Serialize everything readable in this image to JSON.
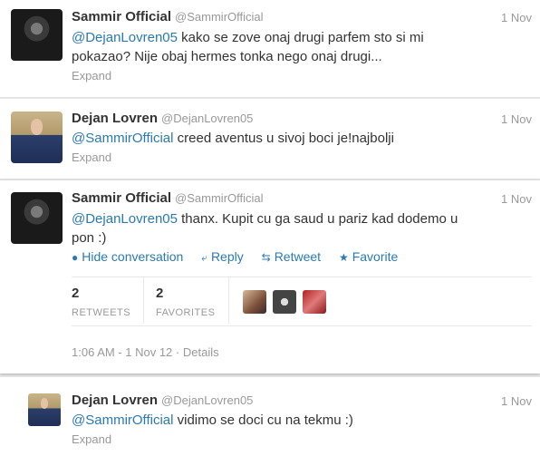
{
  "tweets": [
    {
      "name": "Sammir Official",
      "handle": "@SammirOfficial",
      "date": "1 Nov",
      "mention": "@DejanLovren05",
      "body_line1": " kako se zove onaj drugi parfem sto si mi",
      "body_line2": "pokazao? Nije obaj hermes tonka nego onaj drugi...",
      "expand": "Expand",
      "avatar_icon": "player-avatar-dark"
    },
    {
      "name": "Dejan Lovren",
      "handle": "@DejanLovren05",
      "date": "1 Nov",
      "mention": "@SammirOfficial",
      "body_line1": " creed aventus u sivoj boci je!najbolji",
      "expand": "Expand",
      "avatar_icon": "player-avatar-suit"
    },
    {
      "name": "Sammir Official",
      "handle": "@SammirOfficial",
      "date": "1 Nov",
      "mention": "@DejanLovren05",
      "body_line1": " thanx. Kupit cu ga saud u pariz kad dodemo u",
      "body_line2": "pon :)",
      "actions": {
        "hide": "Hide conversation",
        "reply": "Reply",
        "retweet": "Retweet",
        "favorite": "Favorite"
      },
      "stats": {
        "retweets_count": "2",
        "retweets_label": "RETWEETS",
        "favorites_count": "2",
        "favorites_label": "FAVORITES"
      },
      "timestamp": "1:06 AM - 1 Nov 12",
      "details": "Details",
      "separator": "·"
    },
    {
      "name": "Dejan Lovren",
      "handle": "@DejanLovren05",
      "date": "1 Nov",
      "mention": "@SammirOfficial",
      "body_line1": " vidimo se doci cu na tekmu :)",
      "expand": "Expand"
    }
  ],
  "colors": {
    "link": "#2a7ab0",
    "muted": "#999999",
    "text": "#333333"
  }
}
